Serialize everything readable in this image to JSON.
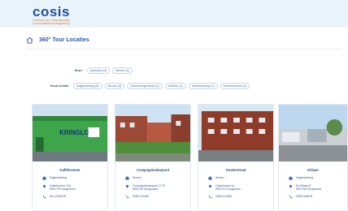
{
  "brand": {
    "name": "cosis",
    "tagline_line1": "Centrum voor ondersteuning",
    "tagline_line2": "& specialistische begeleiding"
  },
  "page": {
    "title": "360° Tour Locaties"
  },
  "filters": {
    "bron_label": "Bron:",
    "bron_options": [
      "Ambulant (3)",
      "Wonen (1)"
    ],
    "soort_label": "Soort locatie:",
    "soort_options": [
      "Dagbesteding (5)",
      "Wonen (3)",
      "Ontmoetingsruimte (1)",
      "Kantoor (1)",
      "Kinderopvang (1)",
      "Kindercentrum (1)"
    ]
  },
  "cards": [
    {
      "name": "Gaffelsoever",
      "type": "Dagbesteding",
      "address_line1": "Gaffelsoever 106",
      "address_line2": "9603 PR Hoogezand",
      "phone": "06-12345678"
    },
    {
      "name": "Compagnieskarpunt",
      "type": "Wonen",
      "address_line1": "Compagnieskarpunt 27-29",
      "address_line2": "9601 BK Hoogezand",
      "phone": "0598-123456"
    },
    {
      "name": "Oosterstraat",
      "type": "Wonen",
      "address_line1": "Oosterstraat 1a",
      "address_line2": "9602 EJ Hoogezand",
      "phone": "0598-123456"
    },
    {
      "name": "Kiliaan",
      "type": "Dagbesteding",
      "address_line1": "De Kiliaan 8",
      "address_line2": "9607 BA Hoogezand",
      "phone": "0598-345678"
    }
  ],
  "photo_text": {
    "sign": "KRINGLOOP"
  },
  "colors": {
    "brand_blue": "#1f4fa0",
    "brand_orange": "#e07a32",
    "topbar_bg": "#e9f3fa"
  }
}
